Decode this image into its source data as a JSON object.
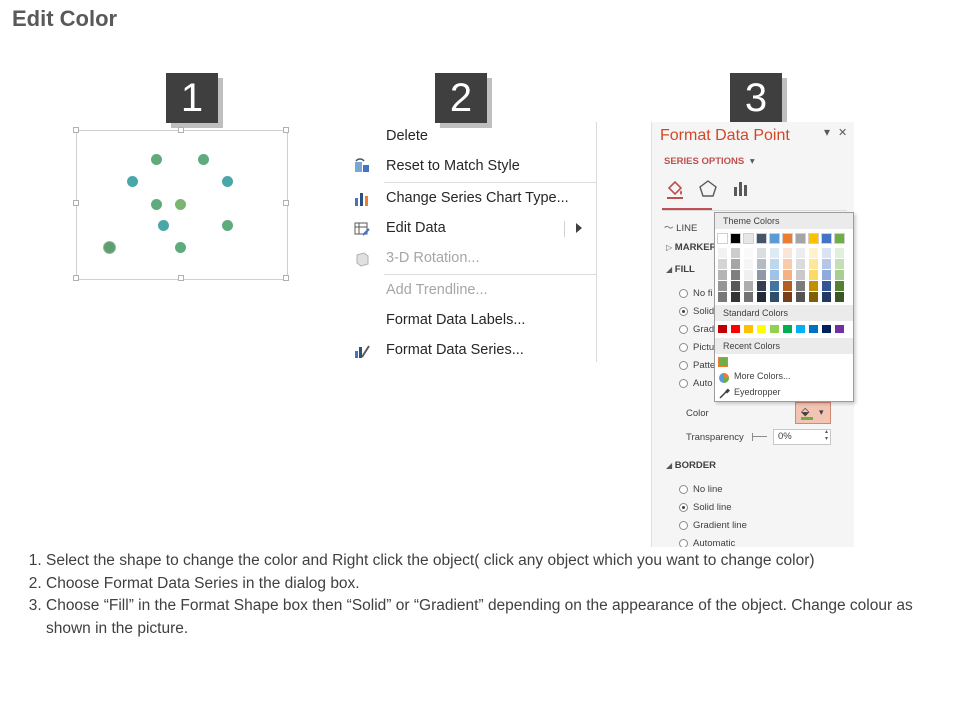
{
  "page": {
    "title": "Edit Color"
  },
  "steps": [
    "1",
    "2",
    "3"
  ],
  "scatter": {
    "colors": {
      "green": "#5fab7e",
      "teal": "#4aa7a8"
    }
  },
  "context_menu": {
    "items": [
      {
        "label": "Delete",
        "icon": "none",
        "disabled": false
      },
      {
        "label": "Reset to Match Style",
        "icon": "reset-style-icon",
        "disabled": false
      },
      {
        "label": "Change Series Chart Type...",
        "icon": "bar-chart-icon",
        "disabled": false
      },
      {
        "label": "Edit Data",
        "icon": "edit-data-icon",
        "disabled": false,
        "submenu": true
      },
      {
        "label": "3-D Rotation...",
        "icon": "cube-icon",
        "disabled": true
      },
      {
        "label": "Add Trendline...",
        "icon": "none",
        "disabled": true
      },
      {
        "label": "Format Data Labels...",
        "icon": "none",
        "disabled": false
      },
      {
        "label": "Format Data Series...",
        "icon": "format-series-icon",
        "disabled": false
      }
    ]
  },
  "format_pane": {
    "title": "Format Data Point",
    "dropdown_glyph": "▾",
    "close_glyph": "✕",
    "series_options": "SERIES OPTIONS",
    "tabs": [
      "fill-line-icon",
      "effects-icon",
      "series-options-icon"
    ],
    "line_label": "LINE",
    "marker_label": "MARKER",
    "fill_label": "FILL",
    "fill_options": [
      "No fi",
      "Solid",
      "Gradi",
      "Pictu",
      "Patte",
      "Auto"
    ],
    "fill_selected": 1,
    "color_label": "Color",
    "transparency_label": "Transparency",
    "transparency_value": "0%",
    "border_label": "BORDER",
    "border_options": [
      "No line",
      "Solid line",
      "Gradient line",
      "Automatic"
    ],
    "border_selected": 1
  },
  "color_picker": {
    "theme_label": "Theme Colors",
    "standard_label": "Standard Colors",
    "recent_label": "Recent Colors",
    "more_colors": "More Colors...",
    "eyedropper": "Eyedropper",
    "theme_top": [
      "#ffffff",
      "#000000",
      "#e7e6e6",
      "#44546a",
      "#5b9bd5",
      "#ed7d31",
      "#a5a5a5",
      "#ffc000",
      "#4472c4",
      "#70ad47"
    ],
    "standard": [
      "#c00000",
      "#ff0000",
      "#ffc000",
      "#ffff00",
      "#92d050",
      "#00b050",
      "#00b0f0",
      "#0070c0",
      "#002060",
      "#7030a0"
    ],
    "recent": [
      "#70ad47"
    ]
  },
  "instructions": [
    "Select the shape to change the color and Right click the object( click any object which you want to change color)",
    "Choose Format Data Series in the dialog box.",
    "Choose “Fill” in the Format Shape box then “Solid” or “Gradient” depending on the appearance of the object. Change colour as shown in the picture."
  ]
}
